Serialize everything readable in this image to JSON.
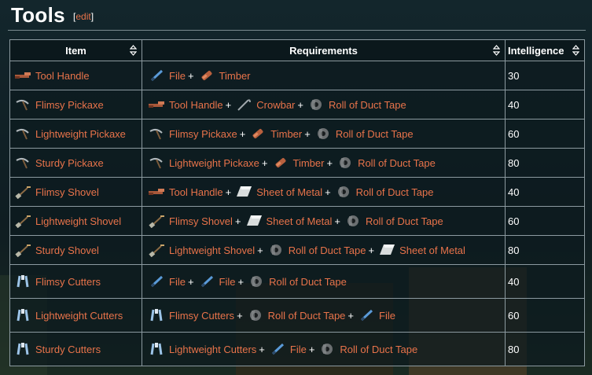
{
  "page": {
    "title": "Tools",
    "edit_label": "edit"
  },
  "columns": [
    {
      "label": "Item"
    },
    {
      "label": "Requirements"
    },
    {
      "label": "Intelligence"
    }
  ],
  "rows": [
    {
      "item": {
        "name": "Tool Handle",
        "icon": "tool-handle-icon"
      },
      "requirements": [
        {
          "name": "File",
          "icon": "file-icon"
        },
        {
          "name": "Timber",
          "icon": "timber-icon"
        }
      ],
      "intelligence": "30"
    },
    {
      "item": {
        "name": "Flimsy Pickaxe",
        "icon": "pickaxe-icon"
      },
      "requirements": [
        {
          "name": "Tool Handle",
          "icon": "tool-handle-icon"
        },
        {
          "name": "Crowbar",
          "icon": "crowbar-icon"
        },
        {
          "name": "Roll of Duct Tape",
          "icon": "duct-tape-icon"
        }
      ],
      "intelligence": "40"
    },
    {
      "item": {
        "name": "Lightweight Pickaxe",
        "icon": "pickaxe-icon"
      },
      "requirements": [
        {
          "name": "Flimsy Pickaxe",
          "icon": "pickaxe-icon"
        },
        {
          "name": "Timber",
          "icon": "timber-icon"
        },
        {
          "name": "Roll of Duct Tape",
          "icon": "duct-tape-icon"
        }
      ],
      "intelligence": "60"
    },
    {
      "item": {
        "name": "Sturdy Pickaxe",
        "icon": "pickaxe-icon"
      },
      "requirements": [
        {
          "name": "Lightweight Pickaxe",
          "icon": "pickaxe-icon"
        },
        {
          "name": "Timber",
          "icon": "timber-icon"
        },
        {
          "name": "Roll of Duct Tape",
          "icon": "duct-tape-icon"
        }
      ],
      "intelligence": "80"
    },
    {
      "item": {
        "name": "Flimsy Shovel",
        "icon": "shovel-icon"
      },
      "requirements": [
        {
          "name": "Tool Handle",
          "icon": "tool-handle-icon"
        },
        {
          "name": "Sheet of Metal",
          "icon": "sheet-metal-icon"
        },
        {
          "name": "Roll of Duct Tape",
          "icon": "duct-tape-icon"
        }
      ],
      "intelligence": "40"
    },
    {
      "item": {
        "name": "Lightweight Shovel",
        "icon": "shovel-icon"
      },
      "requirements": [
        {
          "name": "Flimsy Shovel",
          "icon": "shovel-icon"
        },
        {
          "name": "Sheet of Metal",
          "icon": "sheet-metal-icon"
        },
        {
          "name": "Roll of Duct Tape",
          "icon": "duct-tape-icon"
        }
      ],
      "intelligence": "60"
    },
    {
      "item": {
        "name": "Sturdy Shovel",
        "icon": "shovel-icon"
      },
      "requirements": [
        {
          "name": "Lightweight Shovel",
          "icon": "shovel-icon"
        },
        {
          "name": "Roll of Duct Tape",
          "icon": "duct-tape-icon"
        },
        {
          "name": "Sheet of Metal",
          "icon": "sheet-metal-icon"
        }
      ],
      "intelligence": "80"
    },
    {
      "item": {
        "name": "Flimsy Cutters",
        "icon": "cutters-icon"
      },
      "requirements": [
        {
          "name": "File",
          "icon": "file-icon"
        },
        {
          "name": "File",
          "icon": "file-icon"
        },
        {
          "name": "Roll of Duct Tape",
          "icon": "duct-tape-icon"
        }
      ],
      "intelligence": "40"
    },
    {
      "item": {
        "name": "Lightweight Cutters",
        "icon": "cutters-icon"
      },
      "requirements": [
        {
          "name": "Flimsy Cutters",
          "icon": "cutters-icon"
        },
        {
          "name": "Roll of Duct Tape",
          "icon": "duct-tape-icon"
        },
        {
          "name": "File",
          "icon": "file-icon"
        }
      ],
      "intelligence": "60"
    },
    {
      "item": {
        "name": "Sturdy Cutters",
        "icon": "cutters-icon"
      },
      "requirements": [
        {
          "name": "Lightweight Cutters",
          "icon": "cutters-icon"
        },
        {
          "name": "File",
          "icon": "file-icon"
        },
        {
          "name": "Roll of Duct Tape",
          "icon": "duct-tape-icon"
        }
      ],
      "intelligence": "80"
    }
  ],
  "colors": {
    "background": "#0f1d22",
    "link": "#e8734a",
    "text": "#ffffff",
    "border": "#8c9aa0"
  }
}
